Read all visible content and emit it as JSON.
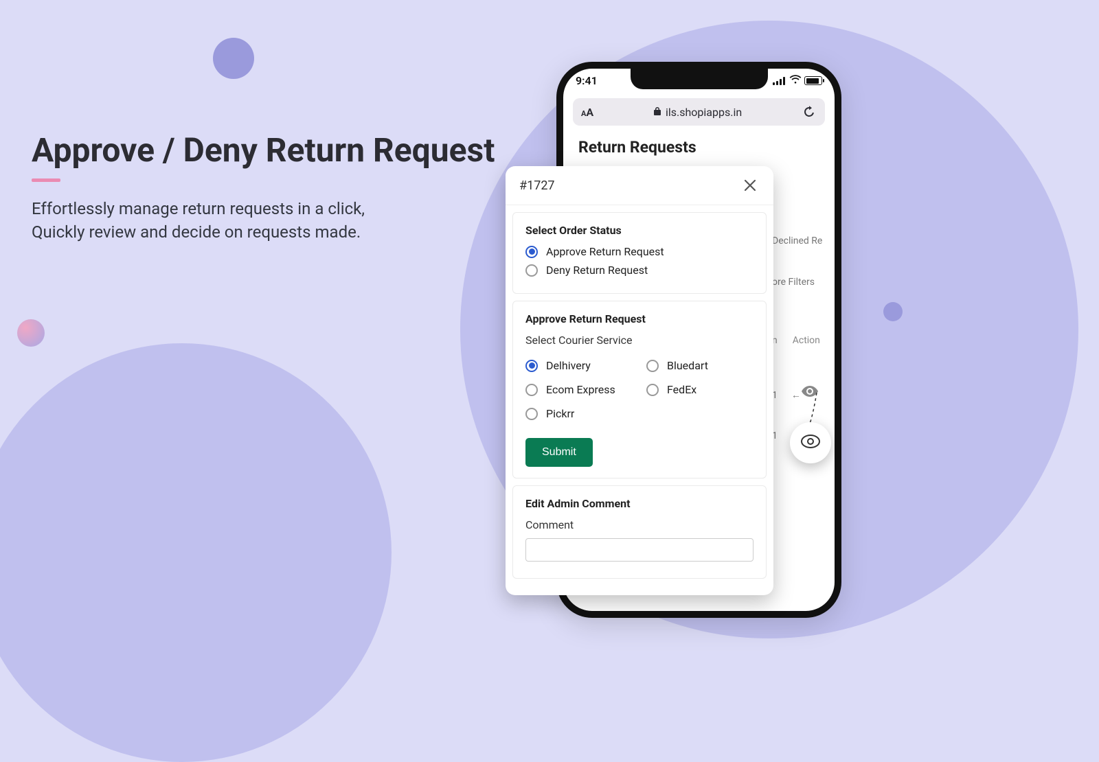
{
  "hero": {
    "title": "Approve / Deny Return Request",
    "subtitle": "Effortlessly manage return requests in a click,\nQuickly review and decide on requests made."
  },
  "phone": {
    "status_time": "9:41",
    "url": "ils.shopiapps.in",
    "page_title": "Return Requests",
    "behind": {
      "declined": "Declined Re",
      "more_filters": "ore Filters",
      "col_on": "n",
      "col_action": "Action",
      "row_val": "1"
    }
  },
  "modal": {
    "order_id": "#1727",
    "section1": {
      "label": "Select Order Status",
      "opt_approve": "Approve Return Request",
      "opt_deny": "Deny Return Request"
    },
    "section2": {
      "label": "Approve Return Request",
      "sublabel": "Select Courier Service",
      "couriers": {
        "delhivery": "Delhivery",
        "bluedart": "Bluedart",
        "ecom": "Ecom Express",
        "fedex": "FedEx",
        "pickrr": "Pickrr"
      },
      "submit": "Submit"
    },
    "section3": {
      "label": "Edit Admin Comment",
      "field_label": "Comment"
    }
  }
}
